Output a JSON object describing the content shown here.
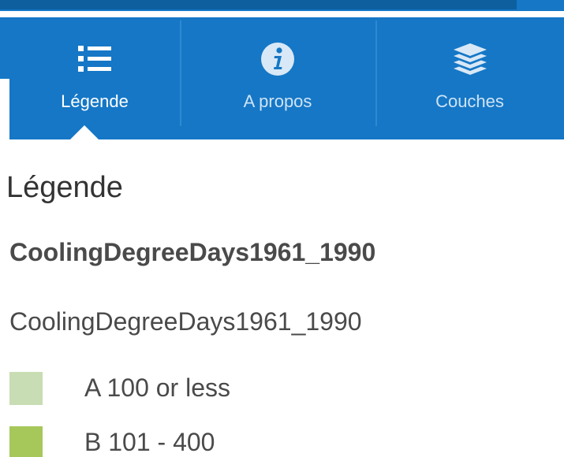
{
  "tabs": [
    {
      "id": "legend",
      "label": "Légende",
      "icon": "list-icon",
      "active": true
    },
    {
      "id": "about",
      "label": "A propos",
      "icon": "info-icon",
      "active": false
    },
    {
      "id": "layers",
      "label": "Couches",
      "icon": "layers-icon",
      "active": false
    }
  ],
  "legend": {
    "title": "Légende",
    "layer_name": "CoolingDegreeDays1961_1990",
    "sublayer_name": "CoolingDegreeDays1961_1990",
    "items": [
      {
        "label": "A 100 or less",
        "color": "#c8ddb3"
      },
      {
        "label": "B 101 - 400",
        "color": "#a6c85b"
      }
    ]
  },
  "colors": {
    "tabbar": "#1577c6",
    "tab_text_active": "#ffffff",
    "tab_text_inactive": "#cfe3f5",
    "text": "#4a4a4a"
  }
}
